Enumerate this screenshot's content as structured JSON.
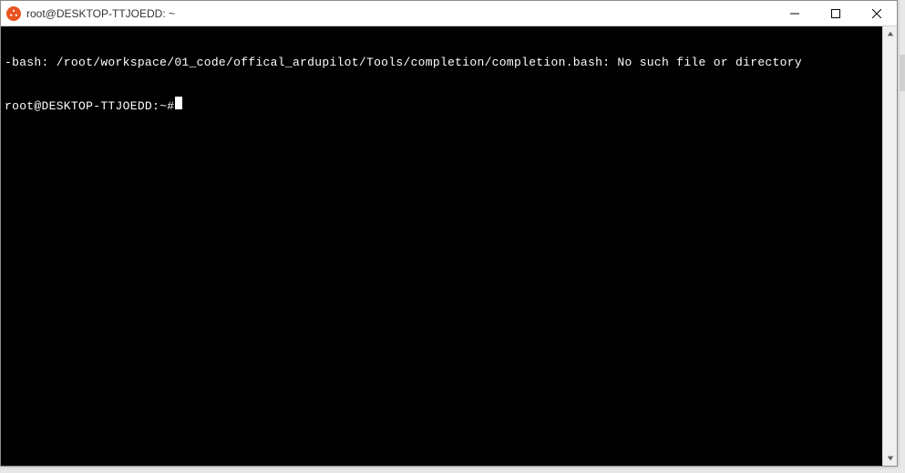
{
  "window": {
    "title": "root@DESKTOP-TTJOEDD: ~"
  },
  "terminal": {
    "lines": [
      "-bash: /root/workspace/01_code/offical_ardupilot/Tools/completion/completion.bash: No such file or directory"
    ],
    "prompt": "root@DESKTOP-TTJOEDD:~#"
  }
}
